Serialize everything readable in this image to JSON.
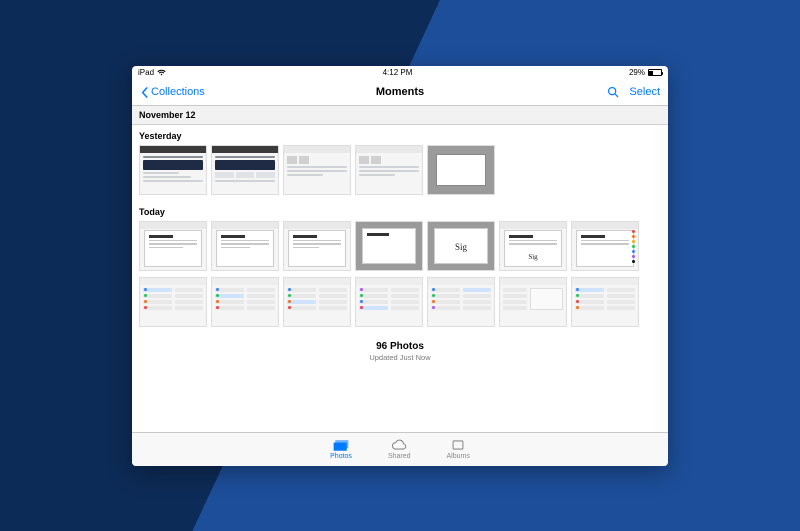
{
  "statusbar": {
    "device": "iPad",
    "time": "4:12 PM",
    "battery_pct": "29%"
  },
  "navbar": {
    "back_label": "Collections",
    "title": "Moments",
    "select_label": "Select"
  },
  "section_date": "November 12",
  "groups": {
    "yesterday": {
      "label": "Yesterday"
    },
    "today": {
      "label": "Today"
    }
  },
  "summary": {
    "count": "96 Photos",
    "updated": "Updated Just Now"
  },
  "tabs": {
    "photos": "Photos",
    "shared": "Shared",
    "albums": "Albums"
  }
}
